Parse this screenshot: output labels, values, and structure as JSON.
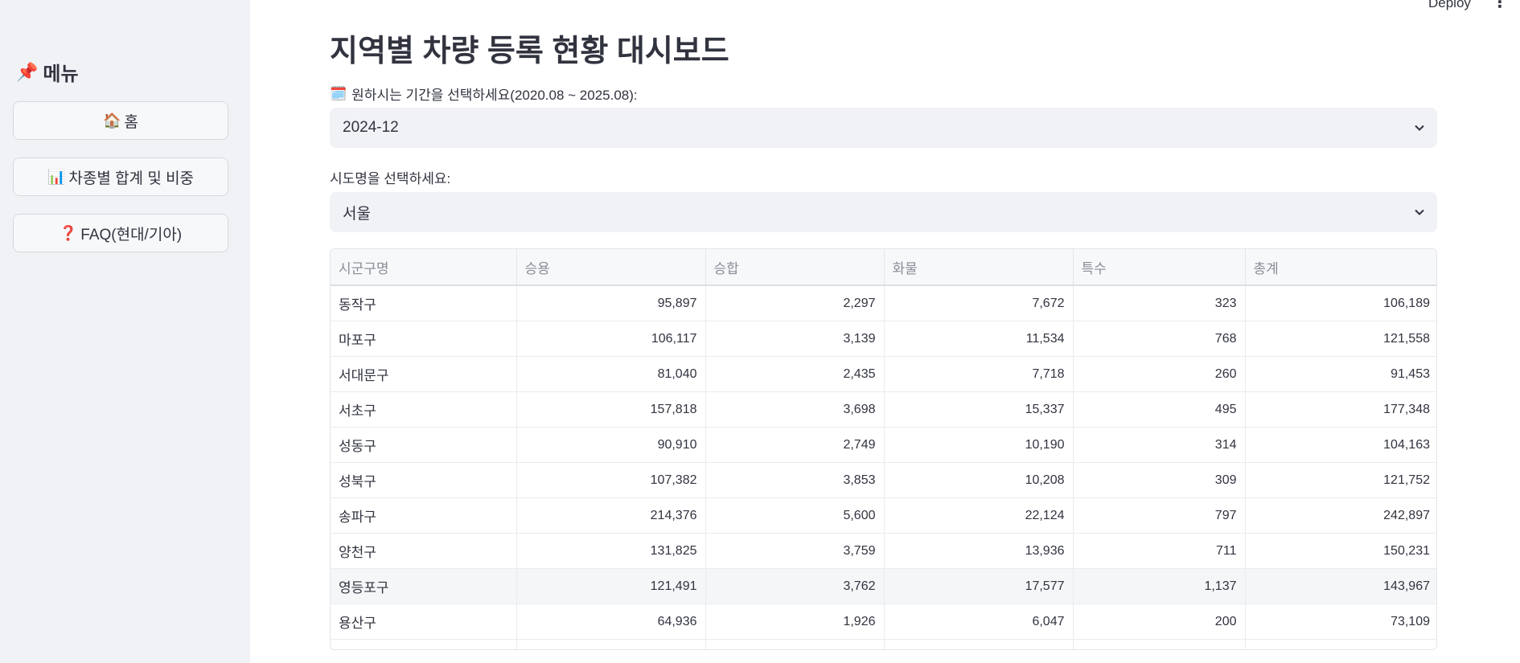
{
  "topbar": {
    "deploy_label": "Deploy",
    "menu_icon": "more-vert-icon"
  },
  "sidebar": {
    "title": "메뉴",
    "title_icon": "📌",
    "items": [
      {
        "icon": "🏠",
        "label": "홈"
      },
      {
        "icon": "📊",
        "label": "차종별 합계 및 비중"
      },
      {
        "icon": "❓",
        "label": "FAQ(현대/기아)"
      }
    ]
  },
  "main": {
    "title": "지역별 차량 등록 현황 대시보드",
    "period": {
      "icon": "🗓️",
      "label": "원하시는 기간을 선택하세요(2020.08 ~ 2025.08):",
      "value": "2024-12"
    },
    "city": {
      "label": "시도명을 선택하세요:",
      "value": "서울"
    },
    "table": {
      "columns": [
        "시군구명",
        "승용",
        "승합",
        "화물",
        "특수",
        "총계"
      ],
      "rows": [
        [
          "동작구",
          "95,897",
          "2,297",
          "7,672",
          "323",
          "106,189"
        ],
        [
          "마포구",
          "106,117",
          "3,139",
          "11,534",
          "768",
          "121,558"
        ],
        [
          "서대문구",
          "81,040",
          "2,435",
          "7,718",
          "260",
          "91,453"
        ],
        [
          "서초구",
          "157,818",
          "3,698",
          "15,337",
          "495",
          "177,348"
        ],
        [
          "성동구",
          "90,910",
          "2,749",
          "10,190",
          "314",
          "104,163"
        ],
        [
          "성북구",
          "107,382",
          "3,853",
          "10,208",
          "309",
          "121,752"
        ],
        [
          "송파구",
          "214,376",
          "5,600",
          "22,124",
          "797",
          "242,897"
        ],
        [
          "양천구",
          "131,825",
          "3,759",
          "13,936",
          "711",
          "150,231"
        ],
        [
          "영등포구",
          "121,491",
          "3,762",
          "17,577",
          "1,137",
          "143,967"
        ],
        [
          "용산구",
          "64,936",
          "1,926",
          "6,047",
          "200",
          "73,109"
        ]
      ],
      "highlighted_row": 8
    }
  }
}
